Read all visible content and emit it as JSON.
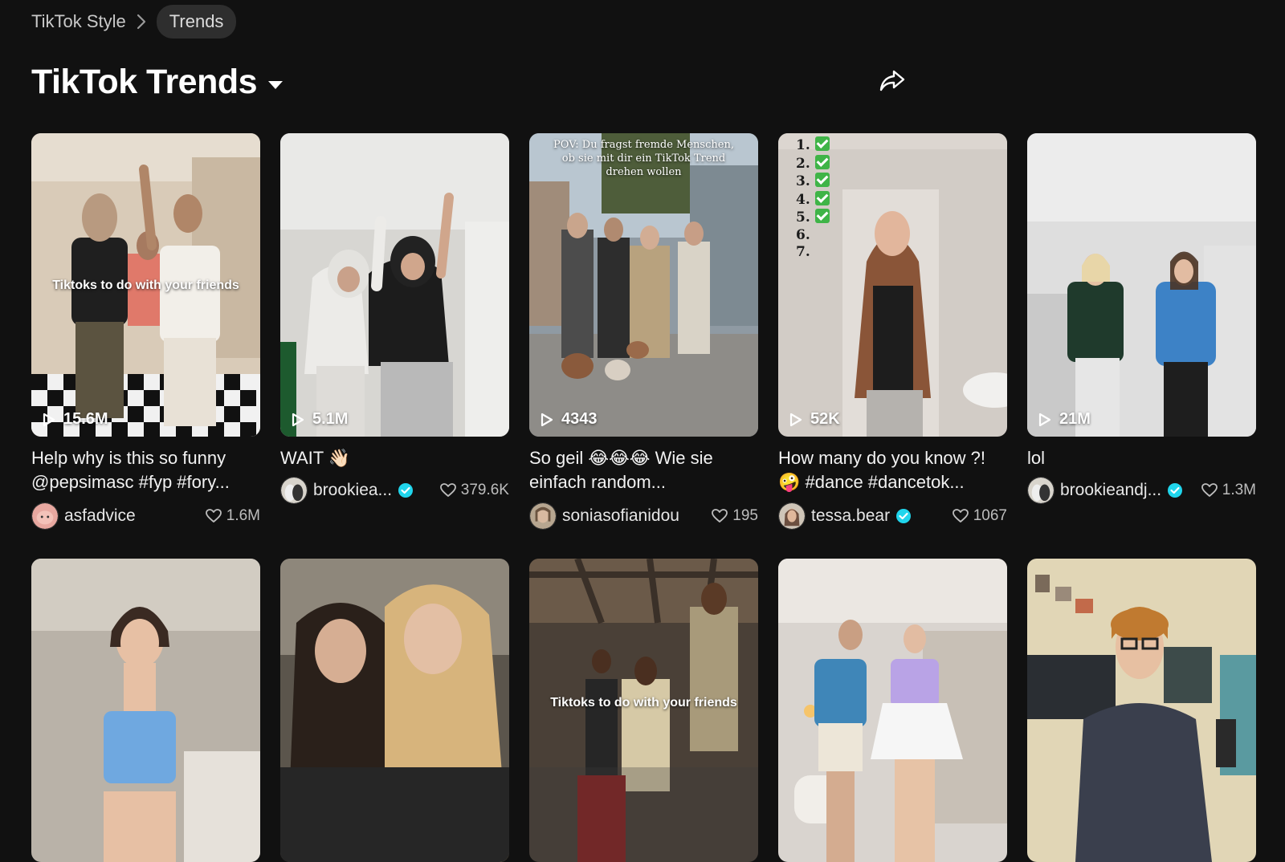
{
  "breadcrumb": {
    "parent": "TikTok Style",
    "current": "Trends"
  },
  "header": {
    "title": "TikTok Trends"
  },
  "videos": [
    {
      "views": "15.6M",
      "overlay": "Tiktoks to do with your friends",
      "caption": "Help why is this so funny @pepsimasc #fyp #fory...",
      "author": "asfadvice",
      "verified": false,
      "likes": "1.6M"
    },
    {
      "views": "5.1M",
      "caption": "WAIT 👋🏻",
      "author": "brookiea...",
      "verified": true,
      "likes": "379.6K"
    },
    {
      "views": "4343",
      "overlay": "POV: Du fragst fremde Menschen, ob sie mit dir ein TikTok Trend drehen wollen",
      "caption": "So geil 😂😂😂 Wie sie einfach random...",
      "author": "soniasofianidou",
      "verified": false,
      "likes": "195"
    },
    {
      "views": "52K",
      "checklist": [
        "1.",
        "2.",
        "3.",
        "4.",
        "5.",
        "6.",
        "7."
      ],
      "caption": "How many do you know ?! 🤪 #dance #dancetok...",
      "author": "tessa.bear",
      "verified": true,
      "likes": "1067"
    },
    {
      "views": "21M",
      "caption": "lol",
      "author": "brookieandj...",
      "verified": true,
      "likes": "1.3M"
    }
  ],
  "row2": [
    {
      "overlay": ""
    },
    {
      "overlay": ""
    },
    {
      "overlay": "Tiktoks to do with your friends"
    },
    {
      "overlay": ""
    },
    {
      "overlay": ""
    }
  ],
  "colors": {
    "background": "#111111",
    "verified": "#20d5ec",
    "accent_text": "#ffffff"
  },
  "icons": [
    "chevron-right-icon",
    "caret-down-icon",
    "share-icon",
    "play-icon",
    "heart-icon",
    "verified-badge-icon"
  ]
}
